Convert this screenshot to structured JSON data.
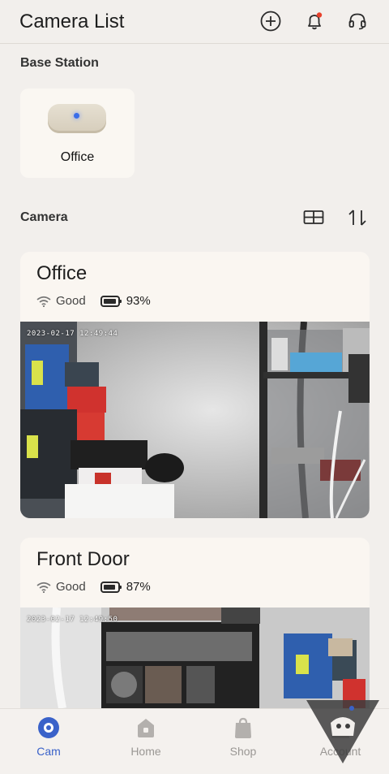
{
  "header": {
    "title": "Camera List",
    "icons": [
      "add-icon",
      "bell-icon",
      "headset-icon"
    ],
    "notification_dot_color": "#e8412c"
  },
  "base_station": {
    "section_label": "Base Station",
    "name": "Office",
    "led_color": "#3b6de8"
  },
  "camera_section": {
    "label": "Camera",
    "icons": [
      "grid-view-icon",
      "sort-icon"
    ]
  },
  "cameras": [
    {
      "name": "Office",
      "signal": "Good",
      "battery": "93%",
      "battery_level": 0.93,
      "timestamp": "2023-02-17 12:49:44"
    },
    {
      "name": "Front Door",
      "signal": "Good",
      "battery": "87%",
      "battery_level": 0.87,
      "timestamp": "2023-02-17 12:49:50"
    }
  ],
  "tabs": [
    {
      "label": "Cam",
      "icon": "cam-icon",
      "active": true
    },
    {
      "label": "Home",
      "icon": "home-icon",
      "active": false
    },
    {
      "label": "Shop",
      "icon": "shop-icon",
      "active": false
    },
    {
      "label": "Account",
      "icon": "account-icon",
      "active": false
    }
  ],
  "colors": {
    "accent": "#3a62c9",
    "background": "#f2efec",
    "card": "#faf6f1"
  }
}
